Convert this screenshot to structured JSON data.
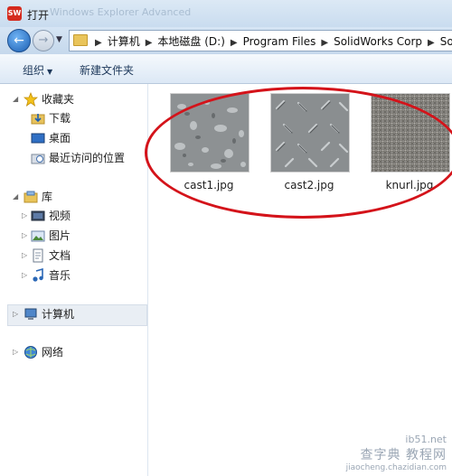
{
  "window": {
    "title": "打开",
    "ghost_title": "Windows Explorer Advanced"
  },
  "address": {
    "crumbs": [
      "计算机",
      "本地磁盘 (D:)",
      "Program Files",
      "SolidWorks Corp",
      "So"
    ]
  },
  "toolbar": {
    "organize": "组织",
    "new_folder": "新建文件夹"
  },
  "sidebar": {
    "favorites": {
      "label": "收藏夹",
      "items": [
        "下载",
        "桌面",
        "最近访问的位置"
      ]
    },
    "libraries": {
      "label": "库",
      "items": [
        "视频",
        "图片",
        "文档",
        "音乐"
      ]
    },
    "computer": "计算机",
    "network": "网络"
  },
  "files": [
    {
      "name": "cast1.jpg",
      "texture": "cast1"
    },
    {
      "name": "cast2.jpg",
      "texture": "cast2"
    },
    {
      "name": "knurl.jpg",
      "texture": "knurl"
    }
  ],
  "watermark": {
    "line1": "ib51.net",
    "line2": "查字典 教程网",
    "line3": "jiaocheng.chazidian.com"
  },
  "colors": {
    "annotation": "#d4131a",
    "accent": "#1c5fb3"
  }
}
